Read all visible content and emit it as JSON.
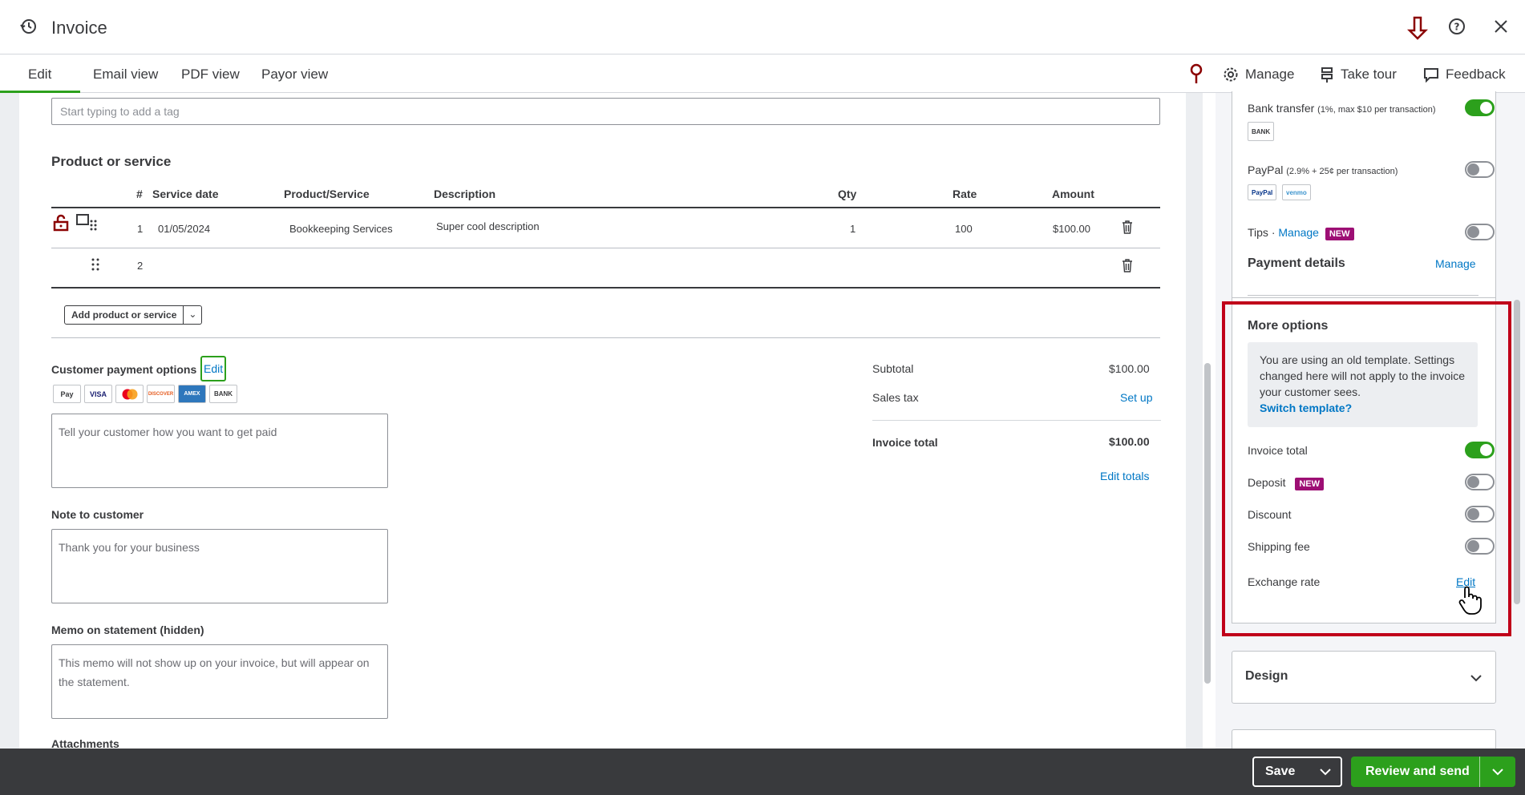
{
  "header": {
    "title": "Invoice"
  },
  "tabs": [
    "Edit",
    "Email view",
    "PDF view",
    "Payor view"
  ],
  "toolbar": {
    "manage": "Manage",
    "take_tour": "Take tour",
    "feedback": "Feedback"
  },
  "tags": {
    "placeholder": "Start typing to add a tag"
  },
  "products": {
    "title": "Product or service",
    "columns": [
      "#",
      "Service date",
      "Product/Service",
      "Description",
      "Qty",
      "Rate",
      "Amount"
    ],
    "rows": [
      {
        "num": "1",
        "date": "01/05/2024",
        "product": "Bookkeeping Services",
        "description": "Super cool description",
        "qty": "1",
        "rate": "100",
        "amount": "$100.00"
      },
      {
        "num": "2",
        "date": "",
        "product": "",
        "description": "",
        "qty": "",
        "rate": "",
        "amount": ""
      }
    ],
    "add_button": "Add product or service"
  },
  "payment_options": {
    "label": "Customer payment options",
    "edit": "Edit",
    "logos": [
      "Pay",
      "VISA",
      "MC",
      "DISCOVER",
      "AMEX",
      "BANK"
    ],
    "placeholder": "Tell your customer how you want to get paid"
  },
  "note": {
    "label": "Note to customer",
    "value": "Thank you for your business"
  },
  "memo": {
    "label": "Memo on statement (hidden)",
    "value": "This memo will not show up on your invoice, but will appear on the statement."
  },
  "attachments": {
    "label": "Attachments"
  },
  "totals": {
    "subtotal_label": "Subtotal",
    "subtotal": "$100.00",
    "sales_tax_label": "Sales tax",
    "sales_tax_action": "Set up",
    "total_label": "Invoice total",
    "total": "$100.00",
    "edit_totals": "Edit totals"
  },
  "right_panel": {
    "bank_transfer": {
      "label": "Bank transfer",
      "fee": "(1%, max $10 per transaction)",
      "logo": "BANK",
      "enabled": true
    },
    "paypal": {
      "label": "PayPal",
      "fee": "(2.9% + 25¢ per transaction)",
      "logos": [
        "PayPal",
        "venmo"
      ],
      "enabled": false
    },
    "tips": {
      "label": "Tips · ",
      "manage": "Manage",
      "badge": "NEW",
      "enabled": false
    },
    "payment_details": {
      "label": "Payment details",
      "manage": "Manage"
    },
    "more_options": {
      "title": "More options",
      "notice": "You are using an old template. Settings changed here will not apply to the invoice your customer sees.",
      "notice_link": "Switch template?",
      "items": [
        {
          "label": "Invoice total",
          "enabled": true
        },
        {
          "label": "Deposit",
          "badge": "NEW",
          "enabled": false
        },
        {
          "label": "Discount",
          "enabled": false
        },
        {
          "label": "Shipping fee",
          "enabled": false
        }
      ],
      "exchange_rate": {
        "label": "Exchange rate",
        "edit": "Edit"
      }
    },
    "design": {
      "title": "Design"
    }
  },
  "footer": {
    "save": "Save",
    "review_send": "Review and send"
  },
  "colors": {
    "accent": "#2ca01c",
    "link": "#0077c5",
    "highlight": "#c0001a",
    "badge": "#9d0f74"
  }
}
